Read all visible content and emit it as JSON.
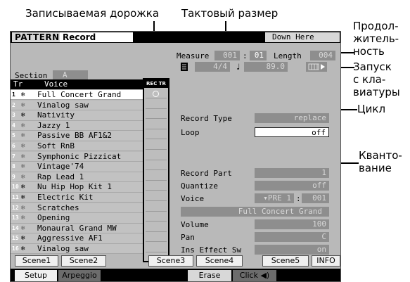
{
  "callouts": {
    "recorded_track": "Записываемая дорожка",
    "meter": "Тактовый размер",
    "duration": [
      "Продол-",
      "житель-",
      "ность"
    ],
    "keyboard_start": [
      "Запуск",
      "с кла-",
      "виатуры"
    ],
    "loop": "Цикл",
    "quantize": [
      "Кванто-",
      "вание"
    ]
  },
  "header": {
    "mode": "PATTERN",
    "title": "Record",
    "song": "Down Here"
  },
  "measure": {
    "label": "Measure",
    "bar": "001",
    "sep": ":",
    "beat": "01"
  },
  "length": {
    "label": "Length",
    "value": "004"
  },
  "time_sig": {
    "icon": "meter-icon",
    "value": "4/4"
  },
  "tempo": {
    "icon": "note-icon",
    "value": "89.0"
  },
  "section": {
    "label": "Section",
    "value": "A"
  },
  "track_list": {
    "col_tr": "Tr",
    "col_voice": "Voice",
    "col_rec": "REC TR",
    "tracks": [
      {
        "num": "1",
        "voice": "Full Concert Grand",
        "flake": true,
        "selected": true
      },
      {
        "num": "2",
        "voice": "Vinalog saw",
        "flake": false
      },
      {
        "num": "3",
        "voice": "Nativity",
        "flake": true
      },
      {
        "num": "4",
        "voice": "Jazzy 1",
        "flake": false
      },
      {
        "num": "5",
        "voice": "Passive BB AF1&2",
        "flake": false
      },
      {
        "num": "6",
        "voice": "Soft RnB",
        "flake": false
      },
      {
        "num": "7",
        "voice": "Symphonic Pizzicat",
        "flake": false
      },
      {
        "num": "8",
        "voice": "Vintage'74",
        "flake": false
      },
      {
        "num": "9",
        "voice": "Rap Lead 1",
        "flake": false
      },
      {
        "num": "10",
        "voice": "Nu Hip Hop Kit 1",
        "flake": true
      },
      {
        "num": "11",
        "voice": "Electric Kit",
        "flake": true
      },
      {
        "num": "12",
        "voice": "Scratches",
        "flake": false
      },
      {
        "num": "13",
        "voice": "Opening",
        "flake": false
      },
      {
        "num": "14",
        "voice": "Monaural Grand MW",
        "flake": false
      },
      {
        "num": "15",
        "voice": "Aggressive AF1",
        "flake": true
      },
      {
        "num": "16",
        "voice": "Vinalog saw",
        "flake": true
      }
    ]
  },
  "params": {
    "record_type": {
      "label": "Record Type",
      "value": "replace"
    },
    "loop": {
      "label": "Loop",
      "value": "off"
    },
    "record_part": {
      "label": "Record Part",
      "value": "1"
    },
    "quantize": {
      "label": "Quantize",
      "value": "off"
    },
    "voice": {
      "label": "Voice",
      "bank": "▾PRE 1",
      "sep": ":",
      "number": "001",
      "name": "Full Concert Grand"
    },
    "volume": {
      "label": "Volume",
      "value": "100"
    },
    "pan": {
      "label": "Pan",
      "value": "C"
    },
    "ins_effect": {
      "label": "Ins Effect Sw",
      "value": "on"
    }
  },
  "scenes": [
    "Scene1",
    "Scene2",
    "Scene3",
    "Scene4",
    "Scene5",
    "INFO"
  ],
  "tabs": {
    "setup": "Setup",
    "arpeggio": "Arpeggio",
    "erase": "Erase",
    "click": "Click ◀)"
  },
  "colors": {
    "lcd_bg": "#b9b9b9",
    "value_box": "#8e8e8e",
    "header_bar": "#000000"
  }
}
